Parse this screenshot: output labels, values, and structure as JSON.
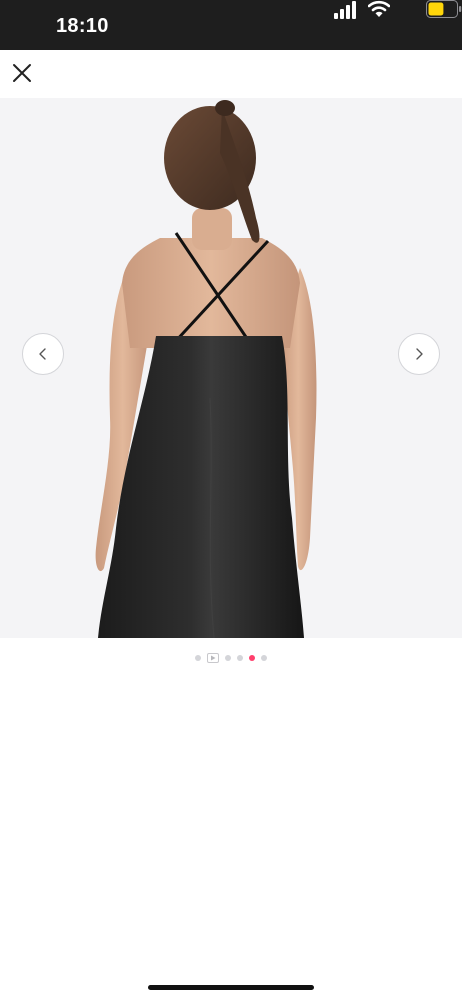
{
  "status_bar": {
    "time": "18:10",
    "signal_icon": "cellular-signal-icon",
    "wifi_icon": "wifi-icon",
    "battery_icon": "battery-icon",
    "battery_color": "#ffd60a",
    "battery_level": 0.55
  },
  "top_bar": {
    "close_icon": "close-icon"
  },
  "gallery": {
    "prev_icon": "chevron-left-icon",
    "next_icon": "chevron-right-icon",
    "total_items": 6,
    "active_index": 4,
    "video_item_index": 1,
    "active_color": "#ff3f6c",
    "inactive_color": "#d4d5d9"
  },
  "colors": {
    "gallery_bg": "#f4f4f6",
    "status_bg": "#1e1e1e"
  }
}
